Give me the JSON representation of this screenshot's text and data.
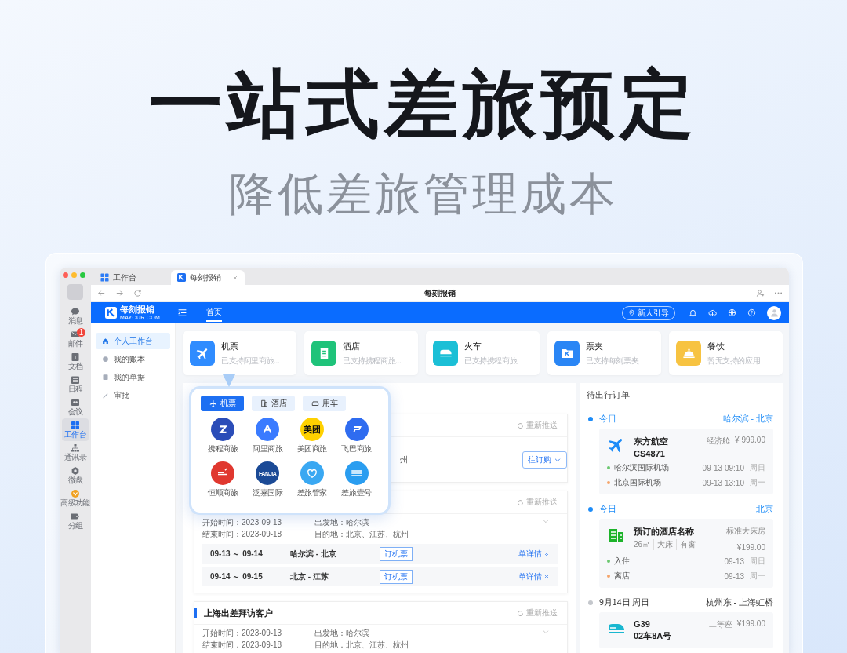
{
  "hero": {
    "title": "一站式差旅预定",
    "subtitle": "降低差旅管理成本"
  },
  "browser": {
    "tabs": [
      {
        "label": "工作台",
        "selected": false
      },
      {
        "label": "每刻报销",
        "selected": true
      }
    ],
    "page_title": "每刻报销"
  },
  "rail": [
    {
      "label": "消息",
      "selected": false
    },
    {
      "label": "邮件",
      "selected": false,
      "badge": "1"
    },
    {
      "label": "文档",
      "selected": false
    },
    {
      "label": "日程",
      "selected": false
    },
    {
      "label": "会议",
      "selected": false
    },
    {
      "label": "工作台",
      "selected": true
    },
    {
      "label": "通讯录",
      "selected": false
    },
    {
      "label": "微盘",
      "selected": false
    },
    {
      "label": "高级功能",
      "selected": false
    },
    {
      "label": "分组",
      "selected": false
    }
  ],
  "header": {
    "logo": "每刻报销",
    "logo_sub": "MAYCUR.COM",
    "nav": [
      {
        "label": "首页",
        "selected": true
      }
    ],
    "guide_button": "新人引导"
  },
  "sidebar": [
    {
      "label": "个人工作台",
      "selected": true
    },
    {
      "label": "我的账本",
      "selected": false
    },
    {
      "label": "我的单据",
      "selected": false
    },
    {
      "label": "审批",
      "selected": false
    }
  ],
  "services": [
    {
      "title": "机票",
      "subtitle": "已支持阿里商旅...",
      "color": "#2f8cff"
    },
    {
      "title": "酒店",
      "subtitle": "已支持携程商旅...",
      "color": "#1fc37a"
    },
    {
      "title": "火车",
      "subtitle": "已支持携程商旅",
      "color": "#1bbfd6"
    },
    {
      "title": "票夹",
      "subtitle": "已支持每刻票夹",
      "color": "#2a86f5"
    },
    {
      "title": "餐饮",
      "subtitle": "暂无支持的应用",
      "color": "#f7c341"
    }
  ],
  "popup": {
    "tabs": [
      {
        "label": "机票",
        "selected": true
      },
      {
        "label": "酒店",
        "selected": false
      },
      {
        "label": "用车",
        "selected": false
      }
    ],
    "apps": [
      {
        "label": "携程商旅",
        "color": "#2b4db8"
      },
      {
        "label": "阿里商旅",
        "color": "#3a7bff"
      },
      {
        "label": "美团商旅",
        "color": "#ffd100",
        "logo_text": "美团"
      },
      {
        "label": "飞巴商旅",
        "color": "#2f6cf0"
      },
      {
        "label": "恒顺商旅",
        "color": "#e0382f"
      },
      {
        "label": "泛嘉国际",
        "color": "#1b4a96",
        "logo_text": "FANJIA"
      },
      {
        "label": "差旅管家",
        "color": "#3aa8f2"
      },
      {
        "label": "差旅壹号",
        "color": "#2a9df0"
      }
    ]
  },
  "orders": [
    {
      "kind": "partial",
      "resend": "重新推送",
      "fragment": "州",
      "action": "往订购"
    },
    {
      "kind": "full",
      "resend": "重新推送",
      "fields": [
        "开始时间：2023-09-13",
        "出发地：哈尔滨",
        "结束时间：2023-09-18",
        "目的地：北京、江苏、杭州"
      ],
      "legs": [
        {
          "dates": "09-13 ～ 09-14",
          "route": "哈尔滨 - 北京",
          "action": "订机票",
          "detail": "单详情"
        },
        {
          "dates": "09-14 ～ 09-15",
          "route": "北京 - 江苏",
          "action": "订机票",
          "detail": "单详情"
        }
      ]
    },
    {
      "kind": "full",
      "title": "上海出差拜访客户",
      "resend": "重新推送",
      "fields": [
        "开始时间：2023-09-13",
        "出发地：哈尔滨",
        "结束时间：2023-09-18",
        "目的地：北京、江苏、杭州"
      ]
    }
  ],
  "pending": {
    "title": "待出行订单",
    "groups": [
      {
        "kind": "flight",
        "highlighted": true,
        "day": "今日",
        "place": "哈尔滨 - 北京",
        "name": "东方航空",
        "code": "CS4871",
        "class": "经济舱",
        "price": "¥ 999.00",
        "stops": [
          {
            "color": "#6cc870",
            "label": "哈尔滨国际机场",
            "time": "09-13 09:10",
            "weekday": "周日"
          },
          {
            "color": "#f5a56a",
            "label": "北京国际机场",
            "time": "09-13 13:10",
            "weekday": "周一"
          }
        ]
      },
      {
        "kind": "hotel",
        "highlighted": true,
        "day": "今日",
        "place": "北京",
        "name": "预订的酒店名称",
        "tags": [
          "26㎡",
          "大床",
          "有窗"
        ],
        "class": "标准大床房",
        "price": "¥199.00",
        "stops": [
          {
            "color": "#6cc870",
            "label": "入住",
            "time": "09-13",
            "weekday": "周日"
          },
          {
            "color": "#f5a56a",
            "label": "离店",
            "time": "09-13",
            "weekday": "周一"
          }
        ]
      },
      {
        "kind": "train",
        "highlighted": false,
        "day": "9月14日 周日",
        "place": "杭州东 - 上海虹桥",
        "name": "G39",
        "code": "02车8A号",
        "class": "二等座",
        "price": "¥199.00"
      }
    ]
  }
}
